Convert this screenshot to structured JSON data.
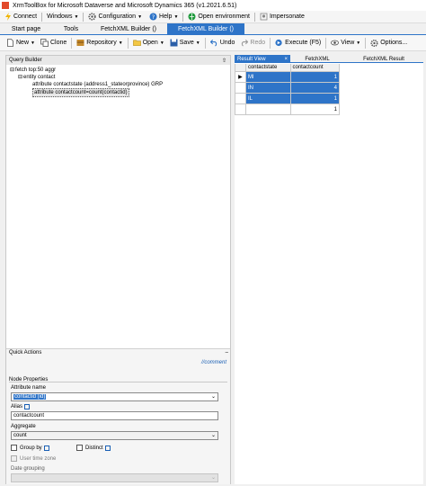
{
  "window": {
    "title": "XrmToolBox for Microsoft Dataverse and Microsoft Dynamics 365 (v1.2021.6.51)"
  },
  "menubar": {
    "connect": "Connect",
    "windows": "Windows",
    "configuration": "Configuration",
    "help": "Help",
    "open_environment": "Open environment",
    "impersonate": "Impersonate"
  },
  "tabs": [
    "Start page",
    "Tools",
    "FetchXML Builder ()",
    "FetchXML Builder ()"
  ],
  "toolbar": {
    "new": "New",
    "clone": "Clone",
    "repository": "Repository",
    "open": "Open",
    "save": "Save",
    "undo": "Undo",
    "redo": "Redo",
    "execute": "Execute (F5)",
    "view": "View",
    "options": "Options..."
  },
  "query_builder": {
    "header": "Query Builder",
    "pin": "⇧",
    "tree": [
      "fetch top:50 aggr",
      "entity contact",
      "attribute contactstate (address1_stateorprovince) GRP",
      "attribute contactcount=count(contactid)"
    ]
  },
  "quick_actions": {
    "header": "Quick Actions",
    "collapse": "–",
    "comment": "//comment",
    "node_properties": "Node Properties",
    "attribute_name_label": "Attribute name",
    "attribute_name_value": "contactid (id)",
    "alias_label": "Alias",
    "alias_value": "contactcount",
    "aggregate_label": "Aggregate",
    "aggregate_value": "count",
    "group_by_label": "Group by",
    "distinct_label": "Distinct",
    "user_time_zone_label": "User time zone",
    "date_grouping_label": "Date grouping",
    "date_grouping_value": ""
  },
  "results": {
    "tabs": [
      "Result View",
      "FetchXML",
      "FetchXML Result"
    ],
    "close": "×",
    "columns": [
      "contactstate",
      "contactcount"
    ],
    "rows": [
      {
        "marker": "▶",
        "state": "MI",
        "count": "1"
      },
      {
        "marker": "",
        "state": "IN",
        "count": "4"
      },
      {
        "marker": "",
        "state": "IL",
        "count": "1"
      },
      {
        "marker": "",
        "state": "",
        "count": "1"
      }
    ]
  },
  "colors": {
    "accent": "#2e74c8",
    "link": "#1a5fb4"
  }
}
